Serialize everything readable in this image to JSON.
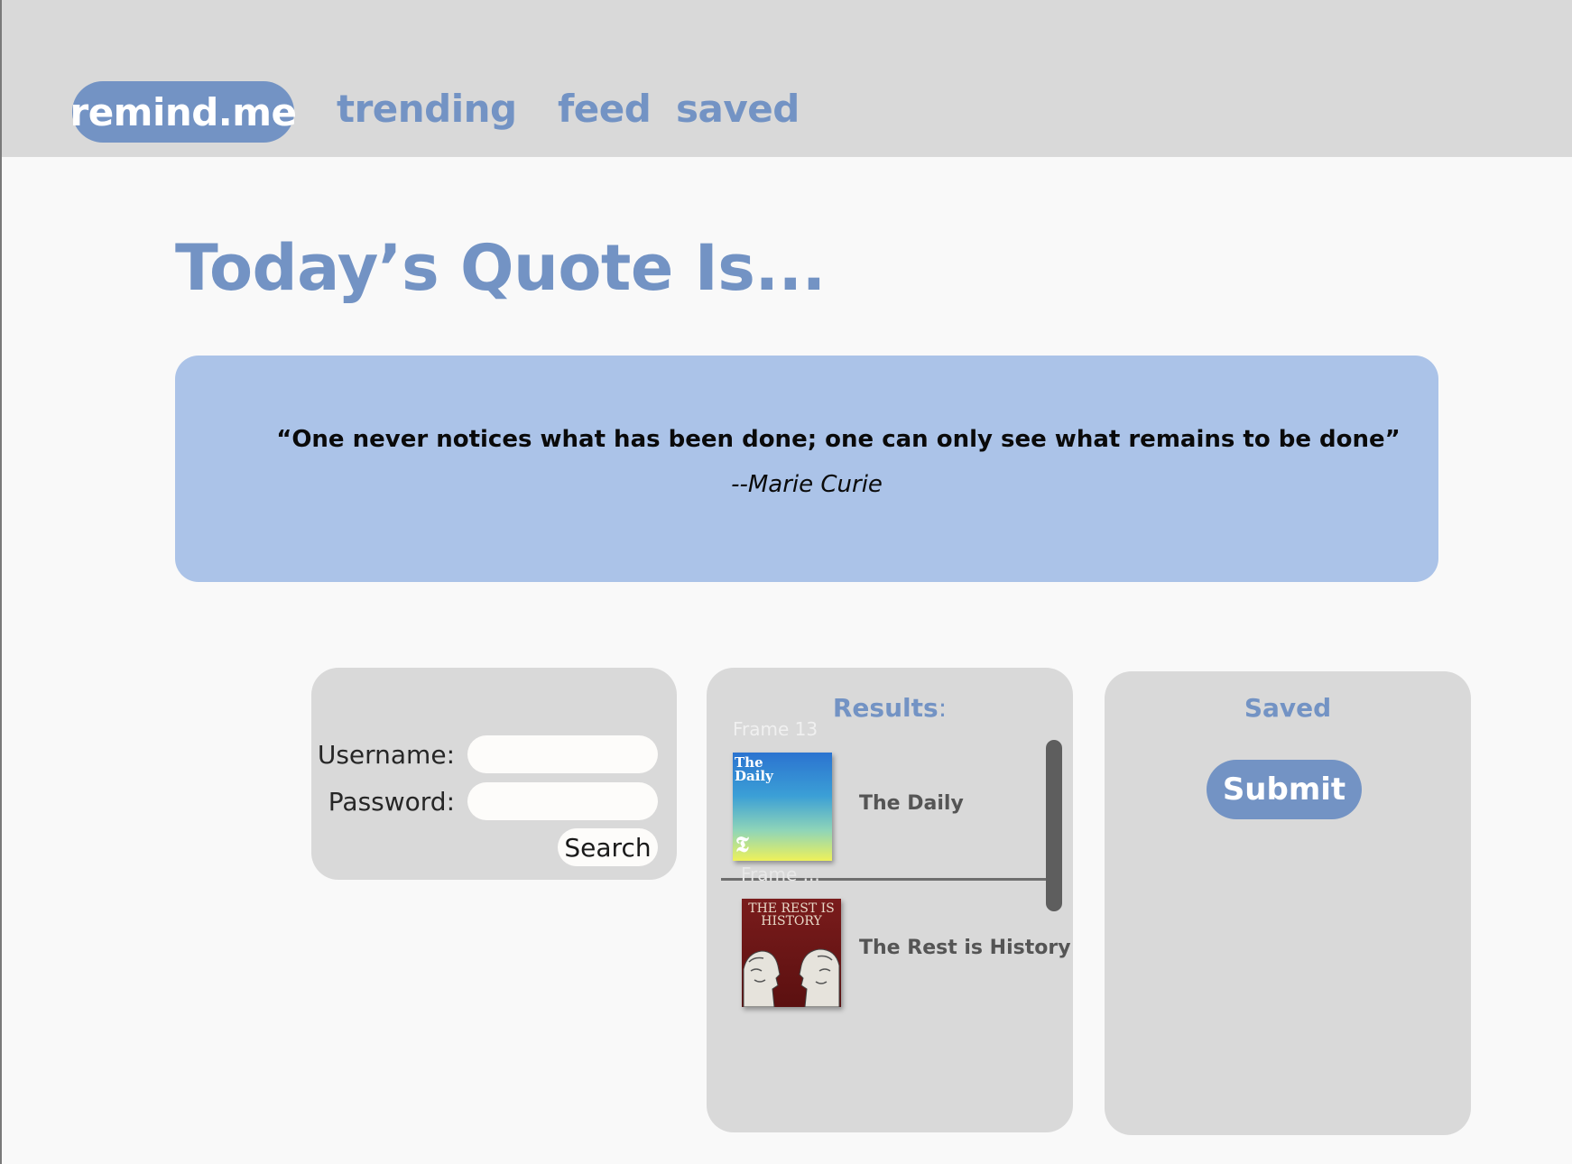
{
  "header": {
    "brand": "remind.me",
    "nav": [
      {
        "label": "trending"
      },
      {
        "label": "feed"
      },
      {
        "label": "saved"
      }
    ]
  },
  "main": {
    "heading": "Today’s Quote Is...",
    "quote": {
      "text": "“One never notices what has been done; one can only see what remains to be done”",
      "author": "--Marie Curie"
    }
  },
  "login": {
    "username_label": "Username:",
    "password_label": "Password:",
    "username_value": "",
    "password_value": "",
    "search_label": "Search"
  },
  "results": {
    "title": "Results",
    "title_suffix": ":",
    "frame_label": "Frame 13",
    "frame_label_2": "Frame ...",
    "items": [
      {
        "title": "The Daily",
        "cover_text": "The Daily",
        "cover_mark": "𝕿"
      },
      {
        "title": "The Rest is History",
        "cover_text": "THE REST IS HISTORY"
      }
    ]
  },
  "saved": {
    "title": "Saved",
    "submit_label": "Submit"
  },
  "colors": {
    "accent": "#7393c4",
    "quote_bg": "#abc3e8",
    "panel_bg": "#d9d9d9",
    "header_bg": "#d9d9d9",
    "page_bg": "#f9f9f9"
  }
}
